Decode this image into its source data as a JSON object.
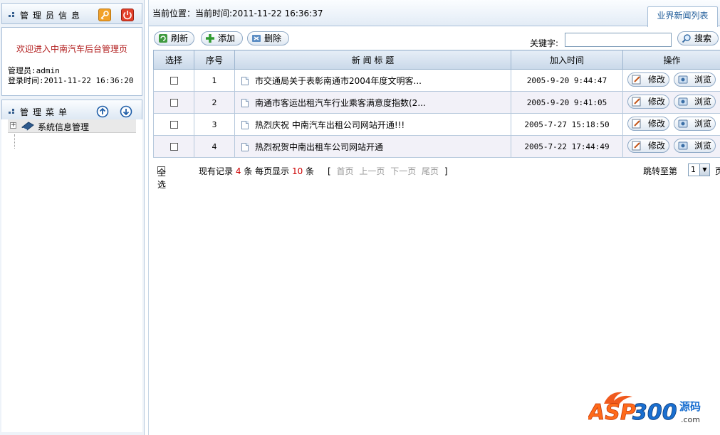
{
  "sidebar": {
    "admin_panel_title": "管理员信息",
    "welcome": "欢迎进入中南汽车后台管理页",
    "admin_line": "管理员:admin",
    "login_line": "登录时间:2011-11-22 16:36:20",
    "menu_panel_title": "管理菜单",
    "menu_items": [
      {
        "label": "系统信息管理"
      }
    ]
  },
  "topbar": {
    "location": "当前位置：当前时间:2011-11-22 16:36:37",
    "tab_label": "业界新闻列表"
  },
  "toolbar": {
    "refresh": "刷新",
    "add": "添加",
    "delete": "删除",
    "keyword_label": "关键字:",
    "keyword_value": "",
    "search": "搜索"
  },
  "table": {
    "headers": [
      "选择",
      "序号",
      "新 闻 标 题",
      "加入时间",
      "操作"
    ],
    "rows": [
      {
        "no": "1",
        "title": "市交通局关于表彰南通市2004年度文明客...",
        "time": "2005-9-20 9:44:47"
      },
      {
        "no": "2",
        "title": "南通市客运出租汽车行业乘客满意度指数(2...",
        "time": "2005-9-20 9:41:05"
      },
      {
        "no": "3",
        "title": "热烈庆祝 中南汽车出租公司网站开通!!!",
        "time": "2005-7-27 15:18:50"
      },
      {
        "no": "4",
        "title": "热烈祝贺中南出租车公司网站开通",
        "time": "2005-7-22 17:44:49"
      }
    ],
    "edit_label": "修改",
    "view_label": "浏览"
  },
  "footer": {
    "select_all": "全选",
    "records_prefix": "现有记录",
    "records_count": "4",
    "records_mid": "条 每页显示",
    "per_page": "10",
    "records_suffix": "条",
    "bracket_open": "[",
    "first": "首页",
    "prev": "上一页",
    "next": "下一页",
    "last": "尾页",
    "bracket_close": "]",
    "jump_label": "跳转至第",
    "jump_value": "1",
    "jump_suffix": "页"
  },
  "watermark": {
    "logo_text": "ASP300源码 .com"
  },
  "colors": {
    "accent": "#1c5a98",
    "welcome": "#b11b1b",
    "count_red": "#cc0000",
    "header_bg": "#c9d8e9"
  }
}
